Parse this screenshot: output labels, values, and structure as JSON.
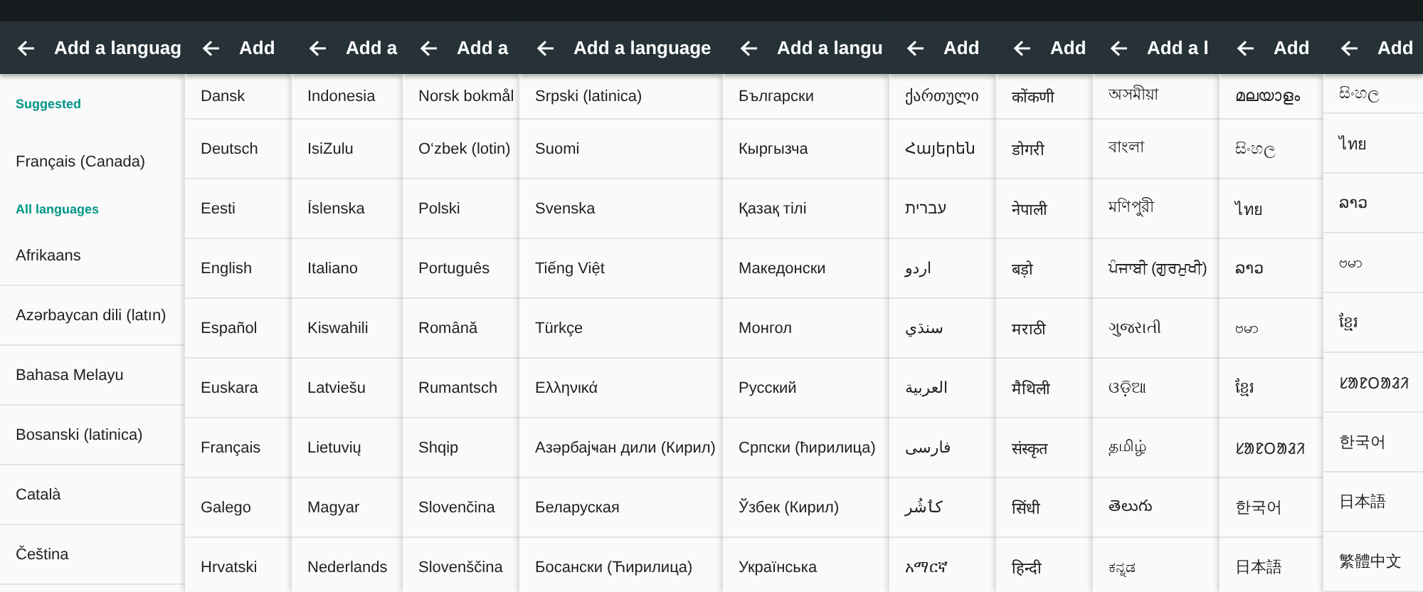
{
  "panels": [
    {
      "title": "Add a languag",
      "items": [
        {
          "kind": "section",
          "text": "Suggested"
        },
        {
          "kind": "language",
          "text": "Français (Canada)"
        },
        {
          "kind": "section",
          "text": "All languages"
        },
        {
          "kind": "language",
          "text": "Afrikaans"
        },
        {
          "kind": "language",
          "text": "Azərbaycan dili (latın)"
        },
        {
          "kind": "language",
          "text": "Bahasa Melayu"
        },
        {
          "kind": "language",
          "text": "Bosanski (latinica)"
        },
        {
          "kind": "language",
          "text": "Català"
        },
        {
          "kind": "language",
          "text": "Čeština"
        }
      ]
    },
    {
      "title": "Add",
      "items": [
        {
          "kind": "language",
          "text": "Dansk"
        },
        {
          "kind": "language",
          "text": "Deutsch"
        },
        {
          "kind": "language",
          "text": "Eesti"
        },
        {
          "kind": "language",
          "text": "English"
        },
        {
          "kind": "language",
          "text": "Español"
        },
        {
          "kind": "language",
          "text": "Euskara"
        },
        {
          "kind": "language",
          "text": "Français"
        },
        {
          "kind": "language",
          "text": "Galego"
        },
        {
          "kind": "language",
          "text": "Hrvatski"
        }
      ]
    },
    {
      "title": "Add a",
      "items": [
        {
          "kind": "language",
          "text": "Indonesia"
        },
        {
          "kind": "language",
          "text": "IsiZulu"
        },
        {
          "kind": "language",
          "text": "Íslenska"
        },
        {
          "kind": "language",
          "text": "Italiano"
        },
        {
          "kind": "language",
          "text": "Kiswahili"
        },
        {
          "kind": "language",
          "text": "Latviešu"
        },
        {
          "kind": "language",
          "text": "Lietuvių"
        },
        {
          "kind": "language",
          "text": "Magyar"
        },
        {
          "kind": "language",
          "text": "Nederlands"
        }
      ]
    },
    {
      "title": "Add a",
      "items": [
        {
          "kind": "language",
          "text": "Norsk bokmål"
        },
        {
          "kind": "language",
          "text": "O‘zbek (lotin)"
        },
        {
          "kind": "language",
          "text": "Polski"
        },
        {
          "kind": "language",
          "text": "Português"
        },
        {
          "kind": "language",
          "text": "Română"
        },
        {
          "kind": "language",
          "text": "Rumantsch"
        },
        {
          "kind": "language",
          "text": "Shqip"
        },
        {
          "kind": "language",
          "text": "Slovenčina"
        },
        {
          "kind": "language",
          "text": "Slovenščina"
        }
      ]
    },
    {
      "title": "Add a language",
      "items": [
        {
          "kind": "language",
          "text": "Srpski (latinica)"
        },
        {
          "kind": "language",
          "text": "Suomi"
        },
        {
          "kind": "language",
          "text": "Svenska"
        },
        {
          "kind": "language",
          "text": "Tiếng Việt"
        },
        {
          "kind": "language",
          "text": "Türkçe"
        },
        {
          "kind": "language",
          "text": "Ελληνικά"
        },
        {
          "kind": "language",
          "text": "Азәрбајҹан дили (Кирил)"
        },
        {
          "kind": "language",
          "text": "Беларуская"
        },
        {
          "kind": "language",
          "text": "Босански (Ћирилица)"
        }
      ]
    },
    {
      "title": "Add a langu",
      "items": [
        {
          "kind": "language",
          "text": "Български"
        },
        {
          "kind": "language",
          "text": "Кыргызча"
        },
        {
          "kind": "language",
          "text": "Қазақ тілі"
        },
        {
          "kind": "language",
          "text": "Македонски"
        },
        {
          "kind": "language",
          "text": "Монгол"
        },
        {
          "kind": "language",
          "text": "Русский"
        },
        {
          "kind": "language",
          "text": "Српски (ћирилица)"
        },
        {
          "kind": "language",
          "text": "Ўзбек (Кирил)"
        },
        {
          "kind": "language",
          "text": "Українська"
        }
      ]
    },
    {
      "title": "Add",
      "items": [
        {
          "kind": "language",
          "text": "ქართული"
        },
        {
          "kind": "language",
          "text": "Հայերեն"
        },
        {
          "kind": "language",
          "text": "עברית"
        },
        {
          "kind": "language",
          "text": "اردو"
        },
        {
          "kind": "language",
          "text": "سنڌي"
        },
        {
          "kind": "language",
          "text": "العربية"
        },
        {
          "kind": "language",
          "text": "فارسی"
        },
        {
          "kind": "language",
          "text": "کٲشُر"
        },
        {
          "kind": "language",
          "text": "አማርኛ"
        }
      ]
    },
    {
      "title": "Add",
      "items": [
        {
          "kind": "language",
          "text": "कोंकणी"
        },
        {
          "kind": "language",
          "text": "डोगरी"
        },
        {
          "kind": "language",
          "text": "नेपाली"
        },
        {
          "kind": "language",
          "text": "बड़ो"
        },
        {
          "kind": "language",
          "text": "मराठी"
        },
        {
          "kind": "language",
          "text": "मैथिली"
        },
        {
          "kind": "language",
          "text": "संस्कृत"
        },
        {
          "kind": "language",
          "text": "सिंधी"
        },
        {
          "kind": "language",
          "text": "हिन्दी"
        }
      ]
    },
    {
      "title": "Add a l",
      "items": [
        {
          "kind": "language",
          "text": "অসমীয়া"
        },
        {
          "kind": "language",
          "text": "বাংলা"
        },
        {
          "kind": "language",
          "text": "মণিপুরী"
        },
        {
          "kind": "language",
          "text": "ਪੰਜਾਬੀ (ਗੁਰਮੁਖੀ)"
        },
        {
          "kind": "language",
          "text": "ગુજરાતી"
        },
        {
          "kind": "language",
          "text": "ଓଡ଼ିଆ"
        },
        {
          "kind": "language",
          "text": "தமிழ்"
        },
        {
          "kind": "language",
          "text": "తెలుగు"
        },
        {
          "kind": "language",
          "text": "ಕನ್ನಡ"
        }
      ]
    },
    {
      "title": "Add",
      "items": [
        {
          "kind": "language",
          "text": "മലയാളം"
        },
        {
          "kind": "language",
          "text": "සිංහල"
        },
        {
          "kind": "language",
          "text": "ไทย"
        },
        {
          "kind": "language",
          "text": "ລາວ"
        },
        {
          "kind": "language",
          "text": "ဗမာ"
        },
        {
          "kind": "language",
          "text": "ខ្មែរ"
        },
        {
          "kind": "language",
          "text": "ᱥᱟᱱᱛᱟᱲᱤ"
        },
        {
          "kind": "language",
          "text": "한국어"
        },
        {
          "kind": "language",
          "text": "日本語"
        }
      ]
    },
    {
      "title": "Add",
      "items": [
        {
          "kind": "language",
          "text": "සිංහල"
        },
        {
          "kind": "language",
          "text": "ไทย"
        },
        {
          "kind": "language",
          "text": "ລາວ"
        },
        {
          "kind": "language",
          "text": "ဗမာ"
        },
        {
          "kind": "language",
          "text": "ខ្មែរ"
        },
        {
          "kind": "language",
          "text": "ᱥᱟᱱᱛᱟᱲᱤ"
        },
        {
          "kind": "language",
          "text": "한국어"
        },
        {
          "kind": "language",
          "text": "日本語"
        },
        {
          "kind": "language",
          "text": "繁體中文"
        }
      ]
    }
  ]
}
